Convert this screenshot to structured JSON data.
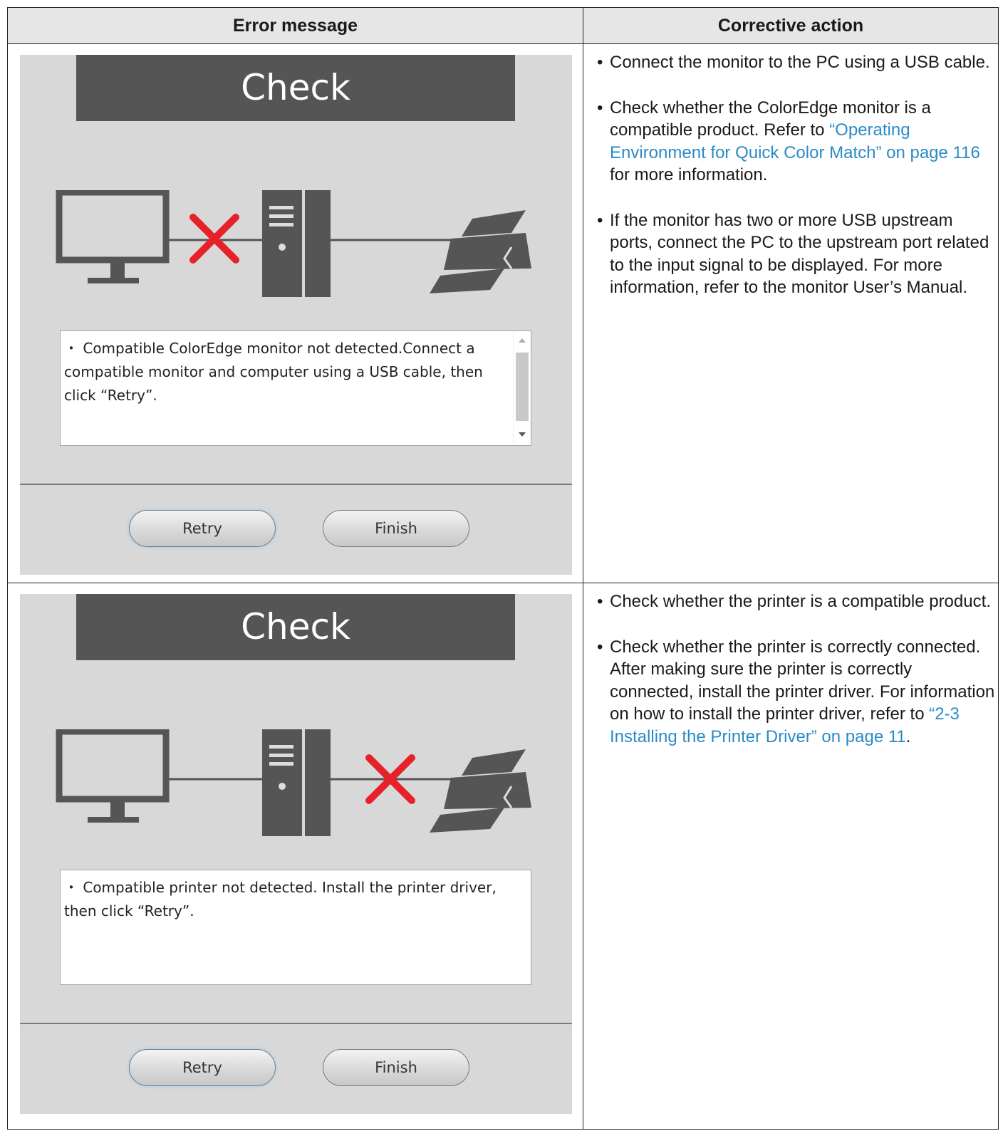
{
  "table": {
    "headers": {
      "error_message": "Error message",
      "corrective_action": "Corrective action"
    },
    "rows": [
      {
        "screen": {
          "title": "Check",
          "message": "・ Compatible ColorEdge monitor not detected.Connect a compatible monitor and computer using a USB cable, then click “Retry”.",
          "retry_label": "Retry",
          "finish_label": "Finish",
          "has_scrollbar": true,
          "broken_link": "monitor-to-computer"
        },
        "actions": [
          {
            "bullet": "•",
            "text": "Connect the monitor to the PC using a USB cable."
          },
          {
            "bullet": "•",
            "pre": "Check whether the ColorEdge monitor is a compatible product. Refer to ",
            "link": "“Operating Environment for Quick Color Match” on page 116",
            "post": " for more information."
          },
          {
            "bullet": "•",
            "text": "If the monitor has two or more USB upstream ports, connect the PC to the upstream port related to the input signal to be displayed. For more information, refer to the monitor User’s Manual."
          }
        ]
      },
      {
        "screen": {
          "title": "Check",
          "message": "・ Compatible printer not detected. Install the printer driver, then click “Retry”.",
          "retry_label": "Retry",
          "finish_label": "Finish",
          "has_scrollbar": false,
          "broken_link": "computer-to-printer"
        },
        "actions": [
          {
            "bullet": "•",
            "text": "Check whether the printer is a compatible product."
          },
          {
            "bullet": "•",
            "pre": "Check whether the printer is correctly connected. After making sure the printer is correctly connected, install the printer driver. For information on how to install the printer driver, refer to ",
            "link": "“2-3 Installing the Printer Driver” on page 11",
            "post": "."
          }
        ]
      }
    ]
  },
  "colors": {
    "link": "#2a8bc6",
    "error_x": "#e8202a",
    "icon_gray": "#555555",
    "screen_bg": "#d8d8d8",
    "header_bg": "#e6e6e6"
  }
}
